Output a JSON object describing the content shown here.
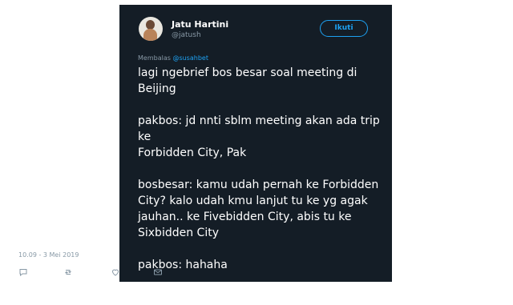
{
  "tweet": {
    "user_name": "Jatu Hartini",
    "user_handle": "@jatush",
    "follow_label": "Ikuti",
    "reply_prefix": "Membalas",
    "reply_to": "@susahbet",
    "text": "lagi ngebrief bos besar soal meeting di\nBeijing\n\npakbos: jd nnti sblm meeting akan ada trip ke\nForbidden City, Pak\n\nbosbesar: kamu udah pernah ke Forbidden\nCity? kalo udah kmu lanjut tu ke yg agak\njauhan.. ke Fivebidden City, abis tu ke\nSixbidden City\n\npakbos: hahaha\n\nme: hahaha",
    "timestamp": "10.09 - 3 Mei 2019"
  },
  "actions": [
    {
      "name": "reply-icon"
    },
    {
      "name": "retweet-icon"
    },
    {
      "name": "like-icon"
    },
    {
      "name": "message-icon"
    }
  ],
  "colors": {
    "background": "#141d26",
    "text": "#ffffff",
    "muted": "#8899a6",
    "accent": "#1da1f2"
  }
}
